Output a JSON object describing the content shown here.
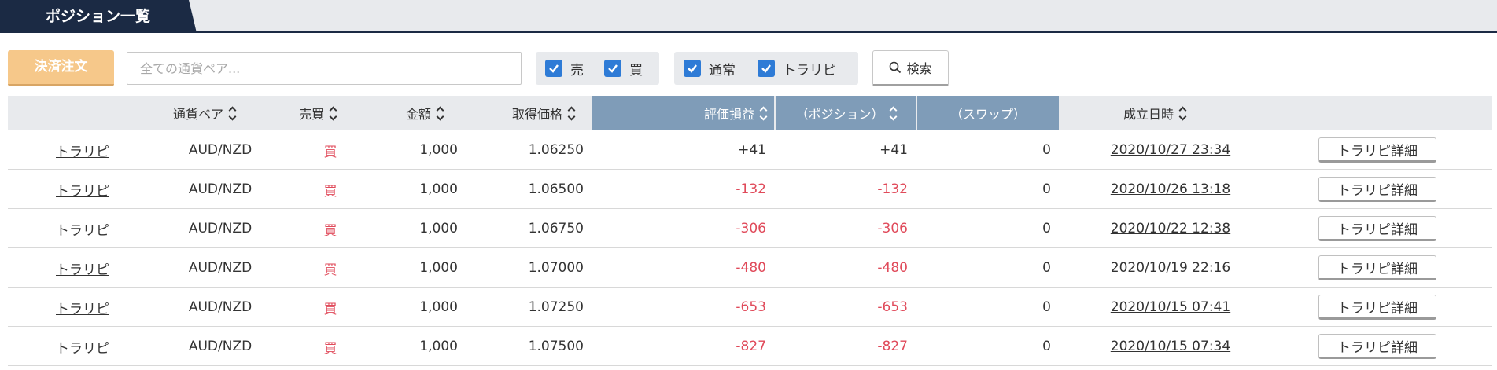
{
  "tabs": {
    "active_label": "ポジション一覧"
  },
  "toolbar": {
    "settle_label": "決済注文",
    "pair_placeholder": "全ての通貨ペア...",
    "pair_value": "",
    "checks": [
      {
        "label": "売",
        "checked": true
      },
      {
        "label": "買",
        "checked": true
      },
      {
        "label": "通常",
        "checked": true
      },
      {
        "label": "トラリピ",
        "checked": true
      }
    ],
    "search_label": "検索"
  },
  "table": {
    "headers": {
      "pair": "通貨ペア",
      "side": "売買",
      "amount": "金額",
      "price": "取得価格",
      "pl": "評価損益",
      "position": "（ポジション）",
      "swap": "（スワップ）",
      "date": "成立日時"
    },
    "detail_button_label": "トラリピ詳細",
    "rows": [
      {
        "type": "トラリピ",
        "pair": "AUD/NZD",
        "side": "買",
        "amount": "1,000",
        "price": "1.06250",
        "pl": "+41",
        "position": "+41",
        "swap": "0",
        "date": "2020/10/27 23:34"
      },
      {
        "type": "トラリピ",
        "pair": "AUD/NZD",
        "side": "買",
        "amount": "1,000",
        "price": "1.06500",
        "pl": "-132",
        "position": "-132",
        "swap": "0",
        "date": "2020/10/26 13:18"
      },
      {
        "type": "トラリピ",
        "pair": "AUD/NZD",
        "side": "買",
        "amount": "1,000",
        "price": "1.06750",
        "pl": "-306",
        "position": "-306",
        "swap": "0",
        "date": "2020/10/22 12:38"
      },
      {
        "type": "トラリピ",
        "pair": "AUD/NZD",
        "side": "買",
        "amount": "1,000",
        "price": "1.07000",
        "pl": "-480",
        "position": "-480",
        "swap": "0",
        "date": "2020/10/19 22:16"
      },
      {
        "type": "トラリピ",
        "pair": "AUD/NZD",
        "side": "買",
        "amount": "1,000",
        "price": "1.07250",
        "pl": "-653",
        "position": "-653",
        "swap": "0",
        "date": "2020/10/15 07:41"
      },
      {
        "type": "トラリピ",
        "pair": "AUD/NZD",
        "side": "買",
        "amount": "1,000",
        "price": "1.07500",
        "pl": "-827",
        "position": "-827",
        "swap": "0",
        "date": "2020/10/15 07:34"
      }
    ]
  },
  "colors": {
    "tab_navy": "#1b2a44",
    "settle_orange": "#f6c88a",
    "checkbox_blue": "#2e7bd6",
    "header_highlight": "#7f9cb8",
    "negative_red": "#e04a5a"
  },
  "icons": {
    "search": "search-icon",
    "check": "check-icon",
    "sort": "sort-icon"
  }
}
